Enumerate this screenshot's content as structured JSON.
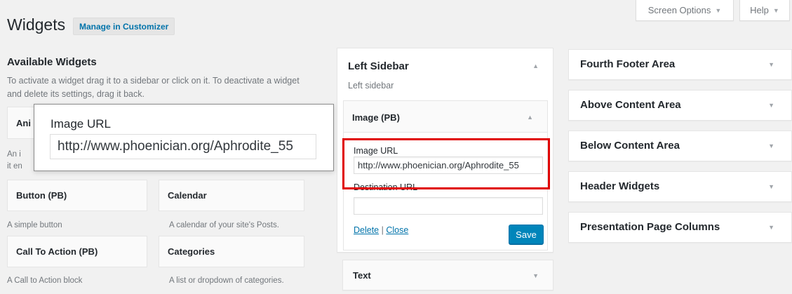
{
  "screen_meta": {
    "screen_options": "Screen Options",
    "help": "Help",
    "arrow": "▼"
  },
  "header": {
    "title": "Widgets",
    "customizer_button": "Manage in Customizer"
  },
  "available": {
    "title": "Available Widgets",
    "description": "To activate a widget drag it to a sidebar or click on it. To deactivate a widget and delete its settings, drag it back.",
    "partial_widget_title": "Ani",
    "partial_desc_1": "An i",
    "partial_desc_2": "it en",
    "widgets": [
      {
        "title": "Button (PB)",
        "desc": "A simple button"
      },
      {
        "title": "Calendar",
        "desc": "A calendar of your site's Posts."
      },
      {
        "title": "Call To Action (PB)",
        "desc": "A Call to Action block"
      },
      {
        "title": "Categories",
        "desc": "A list or dropdown of categories."
      }
    ]
  },
  "left_sidebar": {
    "title": "Left Sidebar",
    "description": "Left sidebar",
    "collapse_arrow": "▲",
    "image_widget": {
      "title": "Image (PB)",
      "image_url_label": "Image URL",
      "image_url_value": "http://www.phoenician.org/Aphrodite_55",
      "destination_url_label": "Destination URL",
      "destination_url_value": "",
      "delete_link": "Delete",
      "separator": "|",
      "close_link": "Close",
      "save_button": "Save"
    },
    "text_widget": {
      "title": "Text"
    }
  },
  "zoom_callout": {
    "label": "Image URL",
    "value": "http://www.phoenician.org/Aphrodite_55"
  },
  "right_areas": [
    {
      "title": "Fourth Footer Area"
    },
    {
      "title": "Above Content Area"
    },
    {
      "title": "Below Content Area"
    },
    {
      "title": "Header Widgets"
    },
    {
      "title": "Presentation Page Columns"
    }
  ],
  "colors": {
    "background": "#f1f1f1",
    "link": "#0073aa",
    "primary_button": "#0085ba",
    "highlight": "#e00000"
  }
}
